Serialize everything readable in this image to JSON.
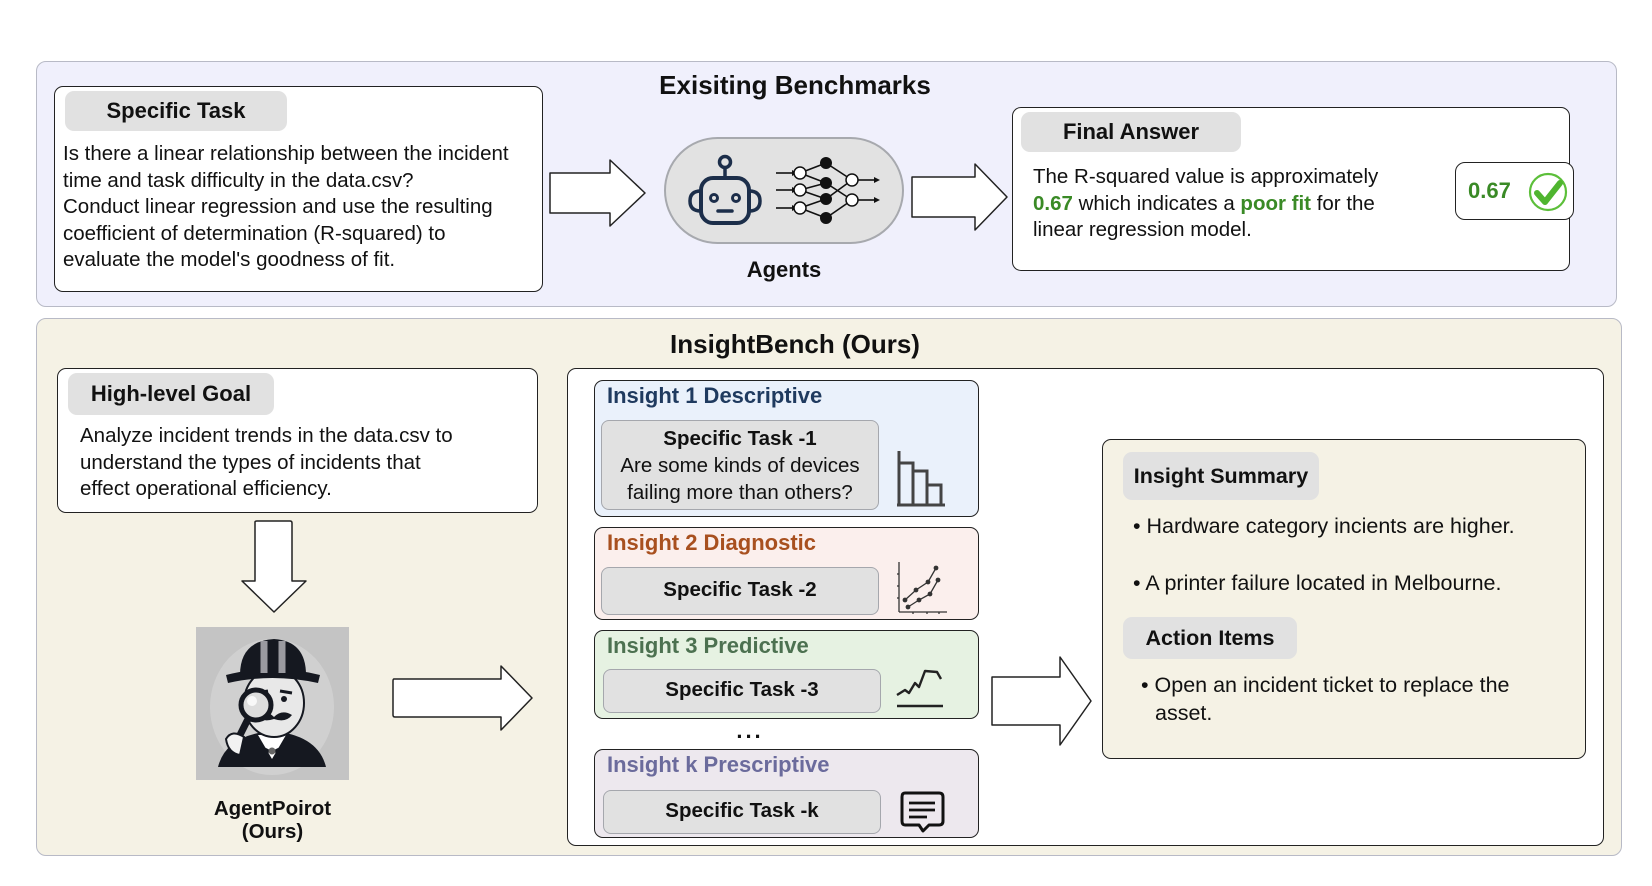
{
  "top_section": {
    "title": "Exisiting Benchmarks",
    "task_card": {
      "header": "Specific Task",
      "lines": [
        "Is there a linear relationship between the incident",
        "time and task difficulty in the data.csv?",
        "Conduct linear regression and use the resulting",
        "coefficient of determination (R-squared) to",
        "evaluate the model's goodness of fit."
      ]
    },
    "agents_label": "Agents",
    "answer_card": {
      "header": "Final Answer",
      "line1": "The R-squared value is approximately",
      "value": "0.67",
      "mid": " which indicates a ",
      "highlight": "poor fit",
      "tail": " for the",
      "line3": "linear regression model."
    },
    "badge": {
      "value": "0.67",
      "icon": "check-circle-icon"
    },
    "colors": {
      "accent_green": "#3a8a26",
      "check_green": "#5cbf3a"
    }
  },
  "bottom_section": {
    "title": "InsightBench (Ours)",
    "goal_card": {
      "header": "High-level Goal",
      "lines": [
        "Analyze incident trends in the data.csv to",
        "understand the types of incidents that",
        "effect operational efficiency."
      ]
    },
    "agent": {
      "name": "AgentPoirot",
      "sub": "(Ours)",
      "icon": "detective-icon"
    },
    "insights": [
      {
        "title": "Insight 1 Descriptive",
        "task": "Specific Task -1",
        "question_lines": [
          "Are some kinds of devices",
          "failing more than others?"
        ],
        "icon": "bar-chart-icon",
        "title_color": "#1f3a5f",
        "bg": "#eaf1fb"
      },
      {
        "title": "Insight 2 Diagnostic",
        "task": "Specific Task -2",
        "icon": "scatter-line-icon",
        "title_color": "#a8501f",
        "bg": "#fbefed"
      },
      {
        "title": "Insight 3 Predictive",
        "task": "Specific Task -3",
        "icon": "trend-line-icon",
        "title_color": "#4c7150",
        "bg": "#e6f2e2"
      },
      {
        "title": "Insight k Prescriptive",
        "task": "Specific Task -k",
        "icon": "message-icon",
        "title_color": "#6b6b9c",
        "bg": "#ede8ee"
      }
    ],
    "ellipsis": "...",
    "summary": {
      "header": "Insight Summary",
      "bullets": [
        "Hardware category incients are higher.",
        "A printer failure located in Melbourne."
      ],
      "actions_header": "Action Items",
      "actions": [
        [
          "Open an incident ticket to replace the",
          "asset."
        ]
      ]
    }
  }
}
